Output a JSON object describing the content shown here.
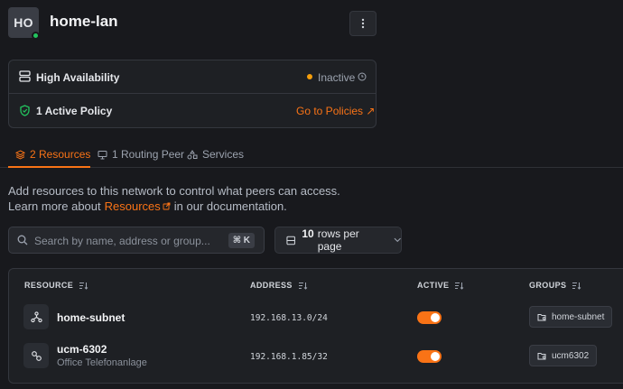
{
  "header": {
    "avatar_initials": "HO",
    "title": "home-lan",
    "more_icon": "vertical-dots-icon"
  },
  "summary_card": {
    "ha_label": "High Availability",
    "ha_status": "Inactive",
    "policy_label": "1 Active Policy",
    "policies_link": "Go to Policies ↗"
  },
  "tabs": [
    {
      "label": "2 Resources",
      "icon": "layers-icon",
      "active": true
    },
    {
      "label": "1 Routing Peer",
      "icon": "monitor-icon",
      "active": false
    },
    {
      "label": "Services",
      "icon": "services-icon",
      "active": false
    }
  ],
  "description": {
    "line1": "Add resources to this network to control what peers can access.",
    "line2_prefix": "Learn more about",
    "line2_link": "Resources",
    "line2_suffix": "in our documentation."
  },
  "search": {
    "placeholder": "Search by name, address or group...",
    "value": "",
    "shortcut": "⌘ K"
  },
  "rows_per_page": {
    "value": "10",
    "suffix": "rows per page"
  },
  "table": {
    "columns": [
      "RESOURCE",
      "ADDRESS",
      "ACTIVE",
      "GROUPS"
    ],
    "rows": [
      {
        "name": "home-subnet",
        "subtitle": "",
        "icon": "network-icon",
        "address": "192.168.13.0/24",
        "active": true,
        "group": "home-subnet"
      },
      {
        "name": "ucm-6302",
        "subtitle": "Office Telefonanlage",
        "icon": "host-icon",
        "address": "192.168.1.85/32",
        "active": true,
        "group": "ucm6302"
      }
    ]
  },
  "colors": {
    "accent": "#f97316",
    "online": "#22c55e",
    "inactive": "#f59e0b",
    "background": "#18191d"
  }
}
